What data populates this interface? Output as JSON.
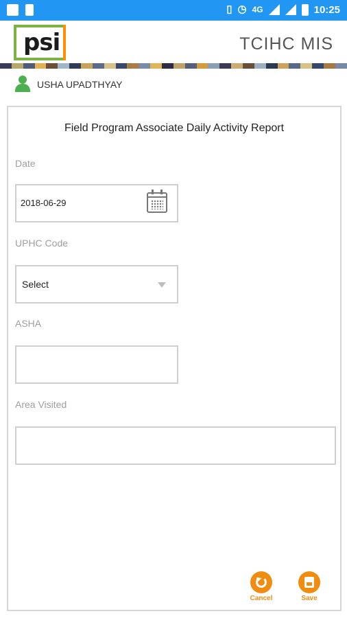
{
  "status_bar": {
    "network": "4G",
    "time": "10:25"
  },
  "app": {
    "logo_text": "psi",
    "title": "TCIHC MIS",
    "stripe_colors": [
      "#3b3b5b",
      "#b8a86a",
      "#4f5d7a",
      "#e5b04f",
      "#6c4f3a",
      "#9fb7c7",
      "#2f3a55",
      "#c7a45a",
      "#5a6c8a",
      "#d9c08a",
      "#384a6a",
      "#a77c45",
      "#7a8aa8",
      "#e0b55a",
      "#2c2c44",
      "#bfa16a",
      "#54607c",
      "#d69a40",
      "#8aa0b8",
      "#3a3a58",
      "#c9ad73",
      "#6b5038",
      "#9db0c2",
      "#2d3954",
      "#caa458",
      "#586a88",
      "#d8c089",
      "#36486a",
      "#a57a44",
      "#7889a7"
    ]
  },
  "user": {
    "name": "USHA UPADTHYAY"
  },
  "form": {
    "title": "Field Program Associate Daily Activity Report",
    "date_label": "Date",
    "date_value": "2018-06-29",
    "uphc_label": "UPHC Code",
    "uphc_value": "Select",
    "asha_label": "ASHA",
    "asha_value": "",
    "area_label": "Area Visited",
    "area_value": ""
  },
  "actions": {
    "cancel_label": "Cancel",
    "save_label": "Save"
  },
  "colors": {
    "status_bar": "#2196f3",
    "accent": "#f08d11",
    "user_icon": "#4caf50"
  }
}
